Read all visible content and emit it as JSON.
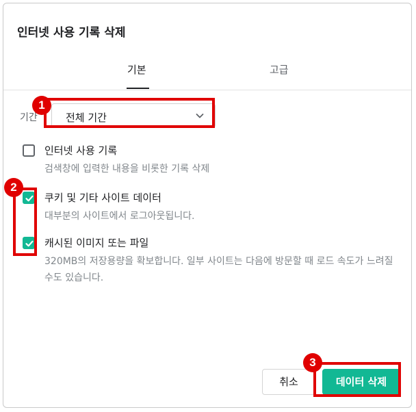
{
  "dialog": {
    "title": "인터넷 사용 기록 삭제",
    "tabs": [
      {
        "label": "기본",
        "selected": true
      },
      {
        "label": "고급",
        "selected": false
      }
    ],
    "period": {
      "label": "기간",
      "value": "전체 기간"
    },
    "options": [
      {
        "title": "인터넷 사용 기록",
        "desc": "검색창에 입력한 내용을 비롯한 기록 삭제",
        "checked": false
      },
      {
        "title": "쿠키 및 기타 사이트 데이터",
        "desc": "대부분의 사이트에서 로그아웃됩니다.",
        "checked": true
      },
      {
        "title": "캐시된 이미지 또는 파일",
        "desc": "320MB의 저장용량을 확보합니다. 일부 사이트는 다음에 방문할 때 로드 속도가 느려질 수도 있습니다.",
        "checked": true
      }
    ],
    "buttons": {
      "cancel": "취소",
      "delete": "데이터 삭제"
    }
  },
  "annotations": {
    "badges": [
      "1",
      "2",
      "3"
    ],
    "color": "#e00000"
  },
  "colors": {
    "accent": "#12b894"
  }
}
